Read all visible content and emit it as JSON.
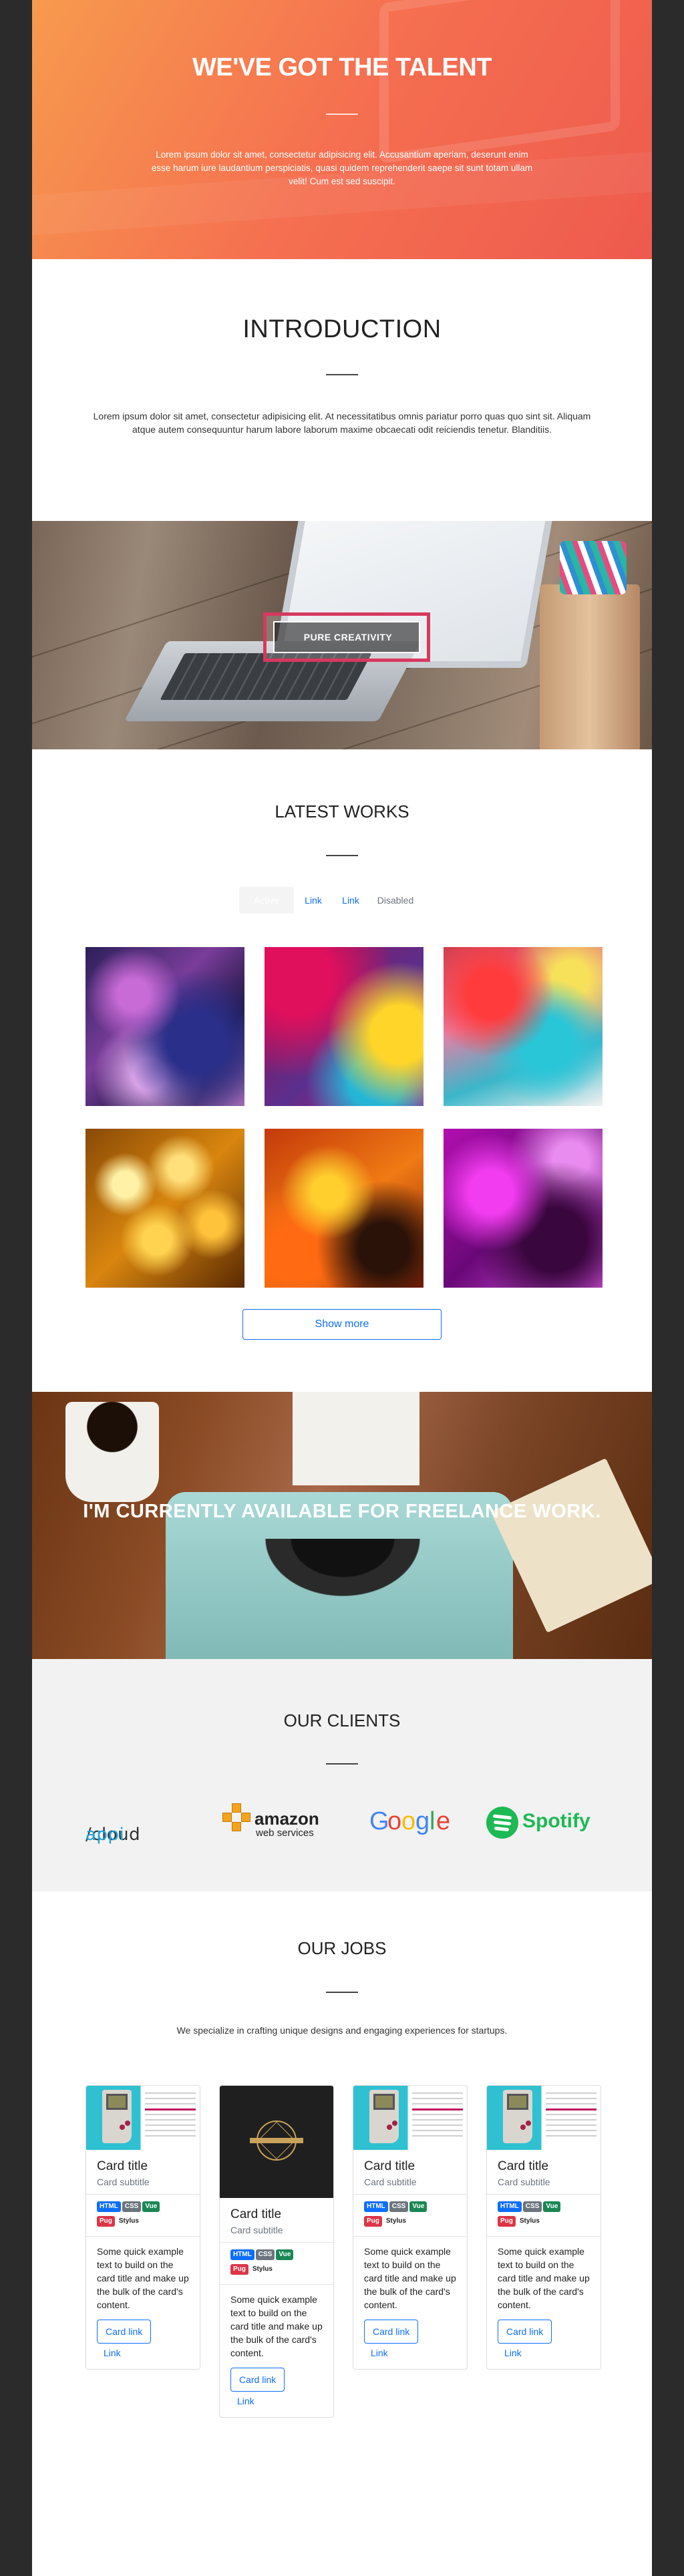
{
  "hero": {
    "title": "WE'VE GOT THE TALENT",
    "text": "Lorem ipsum dolor sit amet, consectetur adipisicing elit. Accusantium aperiam, deserunt enim esse harum iure laudantium perspiciatis, quasi quidem reprehenderit saepe sit sunt totam ullam velit! Cum est sed suscipit."
  },
  "intro": {
    "title": "INTRODUCTION",
    "text": "Lorem ipsum dolor sit amet, consectetur adipisicing elit. At necessitatibus omnis pariatur porro quas quo sint sit. Aliquam atque autem consequuntur harum labore laborum maxime obcaecati odit reiciendis tenetur. Blanditiis."
  },
  "creativity": {
    "label": "PURE CREATIVITY"
  },
  "works": {
    "title": "LATEST WORKS",
    "tabs": [
      {
        "label": "Active"
      },
      {
        "label": "Link"
      },
      {
        "label": "Link"
      },
      {
        "label": "Disabled"
      }
    ],
    "show_more": "Show more"
  },
  "freelance": {
    "text": "I'M CURRENTLY AVAILABLE FOR FREELANCE WORK."
  },
  "clients": {
    "title": "OUR CLIENTS",
    "logos": {
      "cloudappi_a": "/cloud",
      "cloudappi_b": "appi",
      "amazon_a": "amazon",
      "amazon_b": "web services",
      "google": [
        "G",
        "o",
        "o",
        "g",
        "l",
        "e"
      ],
      "spotify": "Spotify"
    }
  },
  "jobs": {
    "title": "OUR JOBS",
    "lead": "We specialize in crafting unique designs and engaging experiences for startups.",
    "cards": [
      {
        "title": "Card title",
        "subtitle": "Card subtitle",
        "tags": [
          "HTML",
          "CSS",
          "Vue",
          "Pug",
          "Stylus"
        ],
        "text": "Some quick example text to build on the card title and make up the bulk of the card's content.",
        "card_link": "Card link",
        "link": "Link"
      },
      {
        "title": "Card title",
        "subtitle": "Card subtitle",
        "tags": [
          "HTML",
          "CSS",
          "Vue",
          "Pug",
          "Stylus"
        ],
        "text": "Some quick example text to build on the card title and make up the bulk of the card's content.",
        "card_link": "Card link",
        "link": "Link"
      },
      {
        "title": "Card title",
        "subtitle": "Card subtitle",
        "tags": [
          "HTML",
          "CSS",
          "Vue",
          "Pug",
          "Stylus"
        ],
        "text": "Some quick example text to build on the card title and make up the bulk of the card's content.",
        "card_link": "Card link",
        "link": "Link"
      },
      {
        "title": "Card title",
        "subtitle": "Card subtitle",
        "tags": [
          "HTML",
          "CSS",
          "Vue",
          "Pug",
          "Stylus"
        ],
        "text": "Some quick example text to build on the card title and make up the bulk of the card's content.",
        "card_link": "Card link",
        "link": "Link"
      }
    ]
  },
  "colors": {
    "hero_gradient_start": "#f79a4e",
    "hero_gradient_end": "#ee5a4e",
    "link_blue": "#0d6efd",
    "badge_border": "#d7385f",
    "clients_bg": "#f2f2f2",
    "outer_bg": "#2b2b2b"
  }
}
